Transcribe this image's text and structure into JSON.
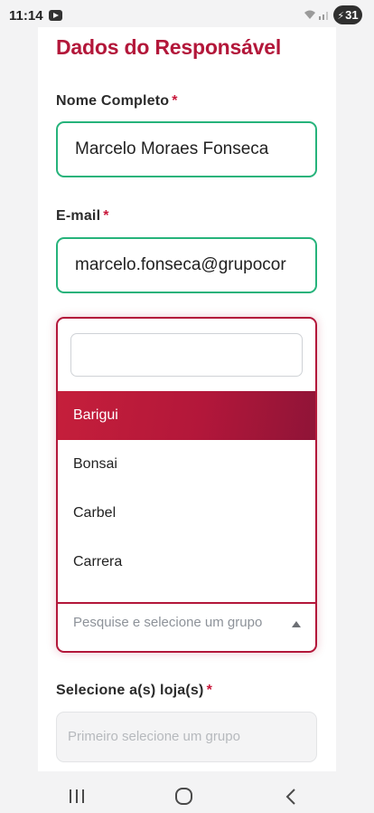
{
  "status_bar": {
    "time": "11:14",
    "battery": "31"
  },
  "form": {
    "section_title": "Dados do Responsável",
    "required_mark": "*",
    "name": {
      "label": "Nome Completo",
      "value": "Marcelo Moraes Fonseca"
    },
    "email": {
      "label": "E-mail",
      "value": "marcelo.fonseca@grupocor"
    },
    "group_select": {
      "search_value": "",
      "options": [
        "Barigui",
        "Bonsai",
        "Carbel",
        "Carrera"
      ],
      "highlighted": "Barigui",
      "placeholder": "Pesquise e selecione um grupo"
    },
    "stores": {
      "label": "Selecione a(s) loja(s)",
      "placeholder": "Primeiro selecione um grupo"
    }
  },
  "colors": {
    "brand": "#b3173a",
    "valid_border": "#26b37b"
  },
  "icons": {
    "media": "play-box-icon",
    "wifi": "wifi-icon",
    "signal": "signal-icon",
    "battery": "battery-charging-icon",
    "nav_recents": "recents-icon",
    "nav_home": "home-icon",
    "nav_back": "back-icon"
  }
}
